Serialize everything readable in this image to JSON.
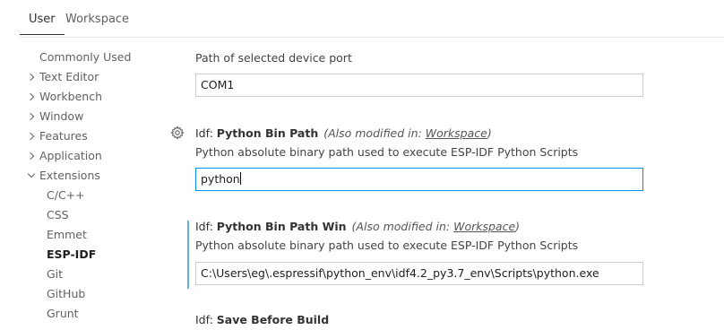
{
  "tabs": [
    {
      "label": "User",
      "active": true
    },
    {
      "label": "Workspace",
      "active": false
    }
  ],
  "toc": [
    {
      "label": "Commonly Used",
      "chevron": "none",
      "child": false
    },
    {
      "label": "Text Editor",
      "chevron": "right",
      "child": false
    },
    {
      "label": "Workbench",
      "chevron": "right",
      "child": false
    },
    {
      "label": "Window",
      "chevron": "right",
      "child": false
    },
    {
      "label": "Features",
      "chevron": "right",
      "child": false
    },
    {
      "label": "Application",
      "chevron": "right",
      "child": false
    },
    {
      "label": "Extensions",
      "chevron": "down",
      "child": false
    },
    {
      "label": "C/C++",
      "chevron": "none",
      "child": true
    },
    {
      "label": "CSS",
      "chevron": "none",
      "child": true
    },
    {
      "label": "Emmet",
      "chevron": "none",
      "child": true
    },
    {
      "label": "ESP-IDF",
      "chevron": "none",
      "child": true,
      "selected": true
    },
    {
      "label": "Git",
      "chevron": "none",
      "child": true
    },
    {
      "label": "GitHub",
      "chevron": "none",
      "child": true
    },
    {
      "label": "Grunt",
      "chevron": "none",
      "child": true
    }
  ],
  "settings": {
    "port": {
      "description": "Path of selected device port",
      "value": "COM1"
    },
    "python_bin_path": {
      "category": "Idf: ",
      "name": "Python Bin Path",
      "also_prefix": "(Also modified in: ",
      "also_link": "Workspace",
      "also_suffix": ")",
      "description": "Python absolute binary path used to execute ESP-IDF Python Scripts",
      "value": "python"
    },
    "python_bin_path_win": {
      "category": "Idf: ",
      "name": "Python Bin Path Win",
      "also_prefix": "(Also modified in: ",
      "also_link": "Workspace",
      "also_suffix": ")",
      "description": "Python absolute binary path used to execute ESP-IDF Python Scripts",
      "value": "C:\\Users\\eg\\.espressif\\python_env\\idf4.2_py3.7_env\\Scripts\\python.exe"
    },
    "save_before_build": {
      "category": "Idf: ",
      "name": "Save Before Build"
    }
  },
  "colors": {
    "focus_border": "#0090f1",
    "modified_indicator": "#66afe0"
  },
  "icons": {
    "setting_gear": "gear-icon"
  }
}
